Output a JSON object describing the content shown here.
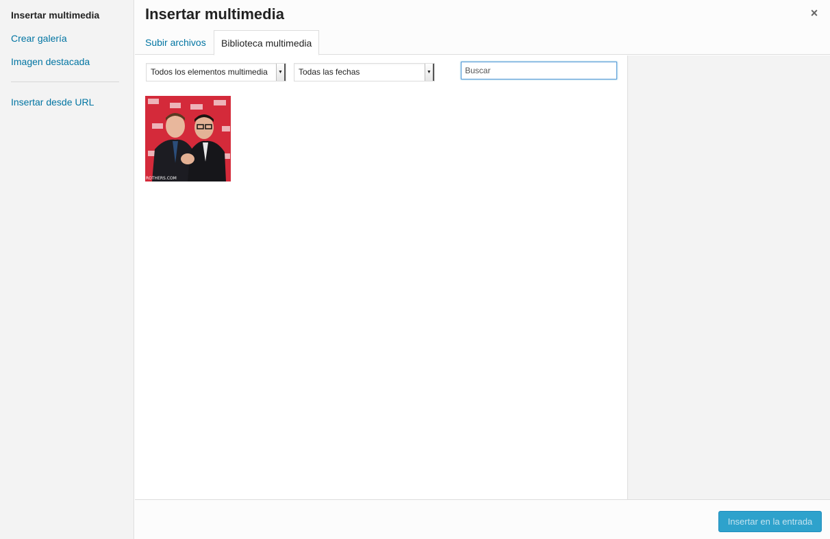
{
  "sidebar": {
    "items": [
      {
        "label": "Insertar multimedia"
      },
      {
        "label": "Crear galería"
      },
      {
        "label": "Imagen destacada"
      },
      {
        "label": "Insertar desde URL"
      }
    ]
  },
  "header": {
    "title": "Insertar multimedia",
    "close": "×",
    "tabs": [
      {
        "label": "Subir archivos"
      },
      {
        "label": "Biblioteca multimedia"
      }
    ]
  },
  "toolbar": {
    "type_filter": "Todos los elementos multimedia",
    "date_filter": "Todas las fechas",
    "search_placeholder": "Buscar",
    "dropdown_arrow": "▼"
  },
  "library": {
    "items": [
      {
        "watermark": "ROTHERS.COM"
      }
    ]
  },
  "footer": {
    "insert_button": "Insertar en la entrada"
  },
  "colors": {
    "link": "#0074a2",
    "primary_button": "#2ea2cc",
    "sidebar_bg": "#f3f3f3"
  }
}
